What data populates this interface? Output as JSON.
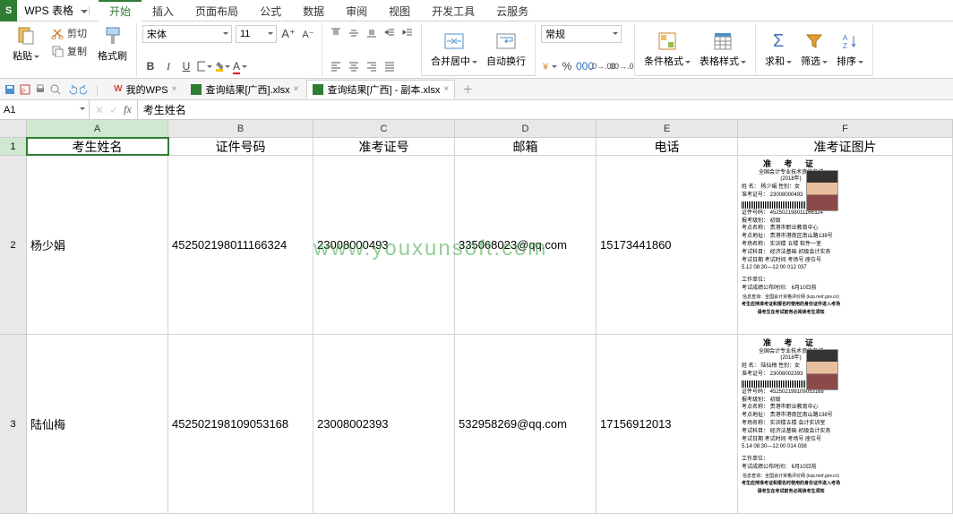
{
  "app": {
    "logo_text": "S",
    "name": "WPS 表格"
  },
  "menu": {
    "tabs": [
      "开始",
      "插入",
      "页面布局",
      "公式",
      "数据",
      "审阅",
      "视图",
      "开发工具",
      "云服务"
    ],
    "active": 0
  },
  "ribbon": {
    "paste": "粘贴",
    "cut": "剪切",
    "copy": "复制",
    "format_painter": "格式刷",
    "font_name": "宋体",
    "font_size": "11",
    "merge_center": "合并居中",
    "auto_wrap": "自动换行",
    "number_format": "常规",
    "cond_fmt": "条件格式",
    "table_style": "表格样式",
    "sum": "求和",
    "filter": "筛选",
    "sort": "排序"
  },
  "doc_tabs": [
    {
      "label": "我的WPS",
      "type": "wps",
      "active": false
    },
    {
      "label": "查询结果[广西].xlsx",
      "type": "xls",
      "active": false
    },
    {
      "label": "查询结果[广西] - 副本.xlsx",
      "type": "xls",
      "active": true
    }
  ],
  "formula": {
    "namebox": "A1",
    "fx": "fx",
    "value": "考生姓名"
  },
  "columns": [
    "A",
    "B",
    "C",
    "D",
    "E",
    "F"
  ],
  "headers": [
    "考生姓名",
    "证件号码",
    "准考证号",
    "邮箱",
    "电话",
    "准考证图片"
  ],
  "rows": [
    {
      "n": "2",
      "name": "杨少娟",
      "id": "452502198011166324",
      "exam": "23008000493",
      "email": "335068023@qq.com",
      "phone": "15173441860",
      "ticket": {
        "title": "准 考 证",
        "sub": "全国会计专业技术资格考试",
        "year": "(2018年)",
        "cand": "姓  名：  杨少娟  性别：女",
        "examlbl": "准考证号：  23008000493",
        "idno": "证件号码：  452502198011166324",
        "level": "报考级别：  初级",
        "site": "考点名称：  贵港市职业教育中心",
        "addr": "考点地址：  贵港市港南区南山路138号",
        "room": "考场名称：  实训楼 五楼 软件一室",
        "subj": "考试科目：  经济法基础  初级会计实务",
        "date": "考试日期    考试时间    考场号    座位号",
        "daterow": "5.12    08:30—12:00    012    037",
        "work": "工作单位：",
        "post": "考试成绩公布时间：  6月10日前",
        "foot1": "信息查询：全国会计资格评价网 (kzp.mof.gov.cn)",
        "foot2": "考生应持准考证和报名时使用的身份证件进入考场",
        "foot3": "请考生在考试前务必阅读考生须知"
      }
    },
    {
      "n": "3",
      "name": "陆仙梅",
      "id": "452502198109053168",
      "exam": "23008002393",
      "email": "532958269@qq.com",
      "phone": "17156912013",
      "ticket": {
        "title": "准 考 证",
        "sub": "全国会计专业技术资格考试",
        "year": "(2018年)",
        "cand": "姓  名：  陆仙梅  性别：女",
        "examlbl": "准考证号：  23008002393",
        "idno": "证件号码：  452502198109053168",
        "level": "报考级别：  初级",
        "site": "考点名称：  贵港市职业教育中心",
        "addr": "考点地址：  贵港市港南区南山路138号",
        "room": "考场名称：  实训楼五楼 会计实训室",
        "subj": "考试科目：  经济法基础  初级会计实务",
        "date": "考试日期    考试时间    考场号    座位号",
        "daterow": "5.14    08:30—12:00    014    038",
        "work": "工作单位：",
        "post": "考试成绩公布时间：  6月10日前",
        "foot1": "信息查询：全国会计资格评价网 (kzp.mof.gov.cn)",
        "foot2": "考生应持准考证和报名时使用的身份证件进入考场",
        "foot3": "请考生在考试前务必阅读考生须知"
      }
    }
  ],
  "watermark": "www.youxunsoft.com"
}
